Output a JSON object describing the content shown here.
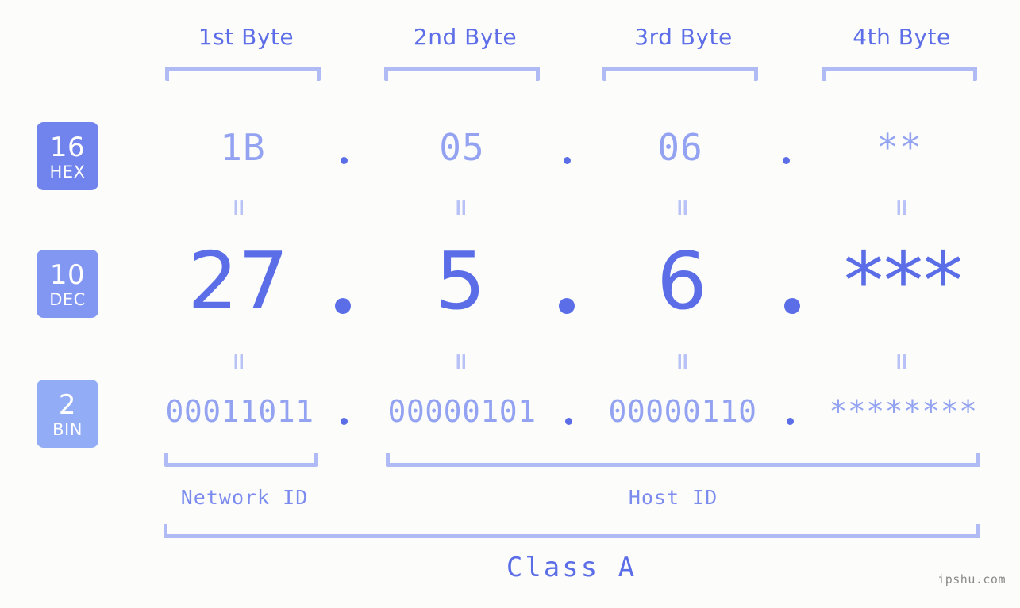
{
  "page": {
    "background_color": "#fcfdfa",
    "accent_color": "#5b6ee8",
    "muted_accent_color": "#93a3f2",
    "bracket_color": "#b0bbf5",
    "watermark": "ipshu.com"
  },
  "byte_headers": [
    {
      "label": "1st Byte"
    },
    {
      "label": "2nd Byte"
    },
    {
      "label": "3rd Byte"
    },
    {
      "label": "4th Byte"
    }
  ],
  "bases": [
    {
      "number": "16",
      "name": "HEX",
      "color": "#7183ed"
    },
    {
      "number": "10",
      "name": "DEC",
      "color": "#8197f2"
    },
    {
      "number": "2",
      "name": "BIN",
      "color": "#92adf5"
    }
  ],
  "rows": {
    "hex": {
      "values": [
        "1B",
        "05",
        "06",
        "**"
      ]
    },
    "dec": {
      "values": [
        "27",
        "5",
        "6",
        "***"
      ]
    },
    "bin": {
      "values": [
        "00011011",
        "00000101",
        "00000110",
        "********"
      ]
    }
  },
  "separators": {
    "dot": ".",
    "equals": "="
  },
  "regions": [
    {
      "label": "Network ID"
    },
    {
      "label": "Host ID"
    }
  ],
  "class": {
    "label": "Class A"
  }
}
